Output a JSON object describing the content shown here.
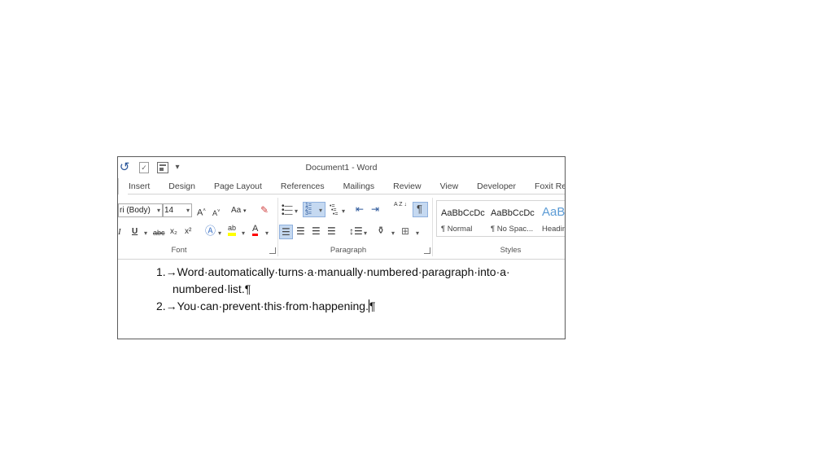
{
  "window": {
    "title": "Document1 - Word"
  },
  "quick_access": [
    "undo-icon",
    "touch-mode-icon",
    "form-icon",
    "customize-dropdown"
  ],
  "tabs": [
    "Insert",
    "Design",
    "Page Layout",
    "References",
    "Mailings",
    "Review",
    "View",
    "Developer",
    "Foxit Re"
  ],
  "ribbon": {
    "font": {
      "font_name": "ri (Body)",
      "font_size": "14",
      "grow": "A",
      "shrink": "A",
      "change_case": "Aa",
      "italic": "I",
      "underline": "U",
      "strikethrough": "abc",
      "subscript": "x₂",
      "superscript": "x²",
      "highlight_label": "ab",
      "font_color_label": "A",
      "group_label": "Font",
      "highlight_color": "#ffff00",
      "font_color": "#ff0000"
    },
    "paragraph": {
      "group_label": "Paragraph",
      "sort_label": "A Z",
      "show_marks": "¶"
    },
    "styles": {
      "group_label": "Styles",
      "items": [
        {
          "sample": "AaBbCcDc",
          "name": "¶ Normal"
        },
        {
          "sample": "AaBbCcDc",
          "name": "¶ No Spac..."
        },
        {
          "sample": "AaBb",
          "name": "Headin"
        }
      ]
    }
  },
  "document": {
    "lines": [
      "1.→Word·automatically·turns·a·manually·numbered·paragraph·into·a·",
      "numbered·list.¶",
      "2.→You·can·prevent·this·from·happening."
    ],
    "line3_end": "¶"
  },
  "colors": {
    "accent": "#2b579a",
    "selected_button": "#c5d9f1"
  }
}
